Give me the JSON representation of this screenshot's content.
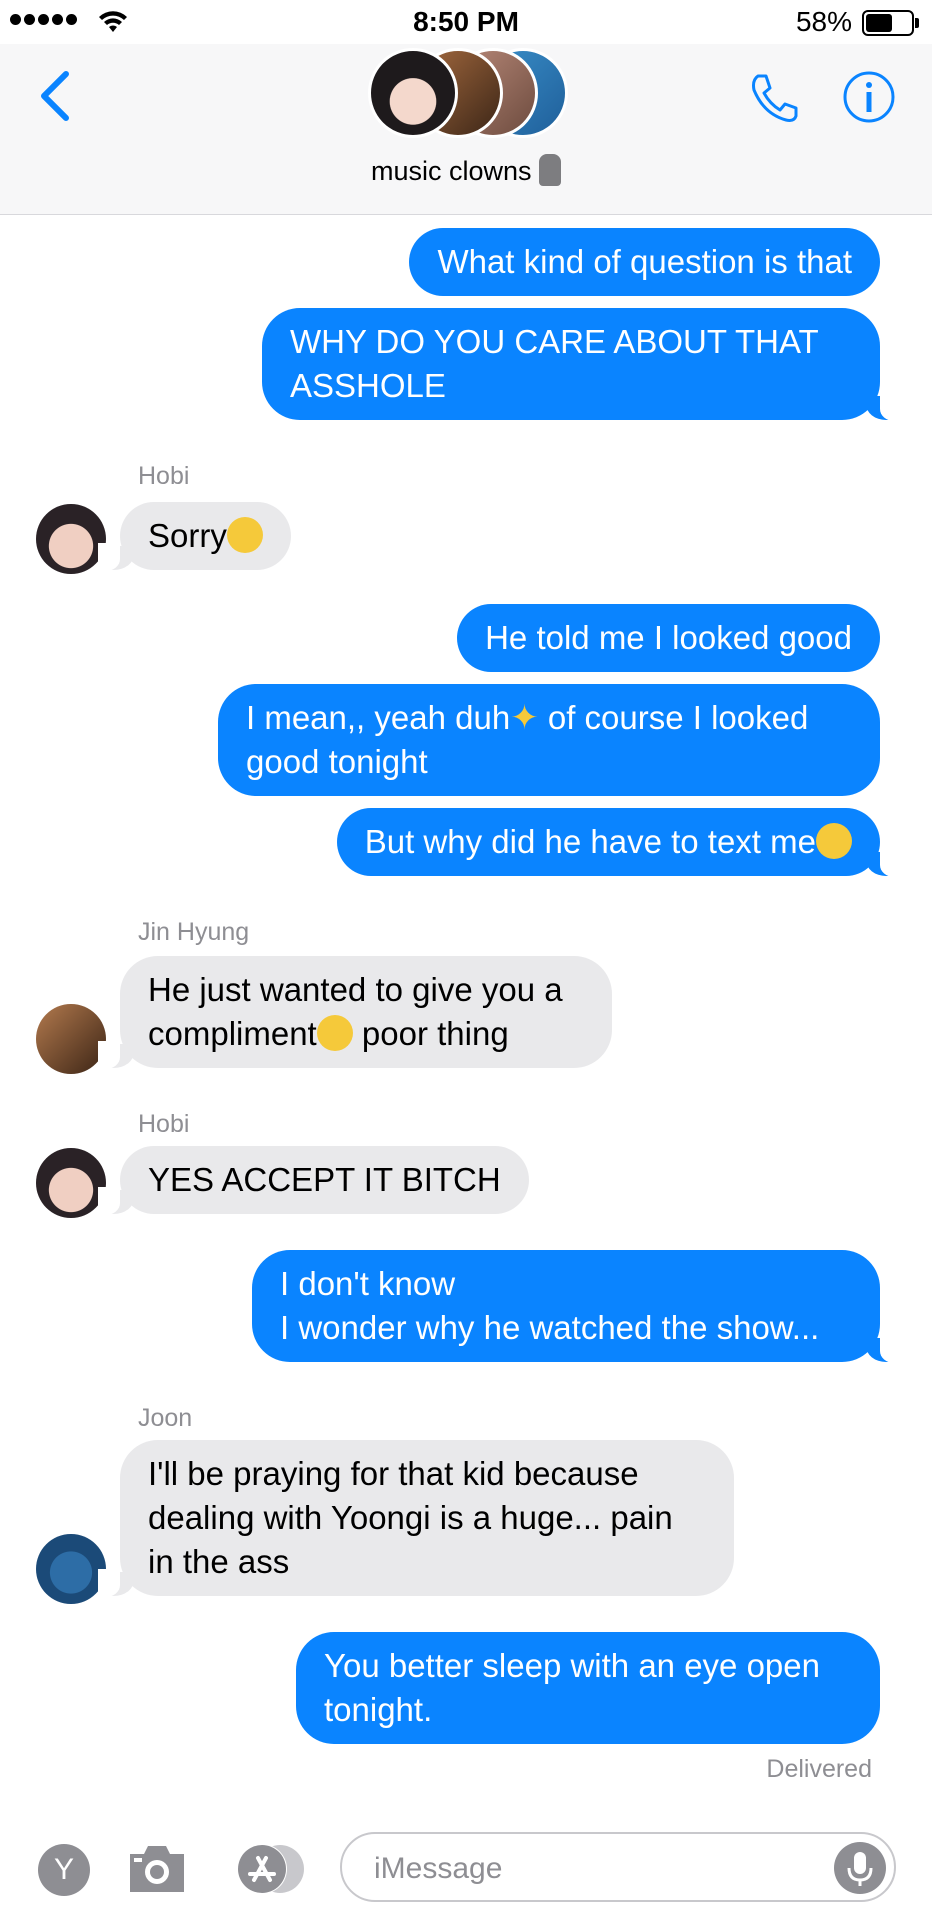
{
  "status_bar": {
    "time": "8:50 PM",
    "battery": "58%"
  },
  "header": {
    "group_name": "music clowns"
  },
  "messages": [
    {
      "from": "me",
      "text": "What kind of question is that"
    },
    {
      "from": "me",
      "text_line1": "WHY DO YOU CARE ABOUT THAT",
      "text_line2": "ASSHOLE"
    },
    {
      "from": "them",
      "sender": "Hobi",
      "text": "Sorry",
      "emoji": "zipper-mouth-emoji"
    },
    {
      "from": "me",
      "text": "He told me I looked good"
    },
    {
      "from": "me",
      "text_a": "I mean,, yeah duh",
      "text_b": " of course I looked",
      "text_line2": "good tonight",
      "emoji": "sparkles-emoji"
    },
    {
      "from": "me",
      "text": "But why did he have to text me",
      "emoji": "smiling-face-emoji"
    },
    {
      "from": "them",
      "sender": "Jin Hyung",
      "text_line1": "He just wanted to give you a",
      "text_a": "compliment",
      "text_b": " poor thing",
      "emoji": "sad-relieved-face-emoji"
    },
    {
      "from": "them",
      "sender": "Hobi",
      "text": "YES ACCEPT IT BITCH"
    },
    {
      "from": "me",
      "text_line1": "I don't know",
      "text_line2": "I wonder why he watched the show..."
    },
    {
      "from": "them",
      "sender": "Joon",
      "text_line1": "I'll be praying for that kid because",
      "text_line2": "dealing with Yoongi is a huge... pain",
      "text_line3": "in the ass"
    },
    {
      "from": "me",
      "text_line1": "You better sleep with an eye open",
      "text_line2": "tonight."
    }
  ],
  "delivered_label": "Delivered",
  "input_bar": {
    "placeholder": "iMessage",
    "avatar_letter": "Y"
  },
  "colors": {
    "accent": "#0a84ff",
    "incoming": "#e9e9eb",
    "meta_text": "#8e8e93"
  }
}
